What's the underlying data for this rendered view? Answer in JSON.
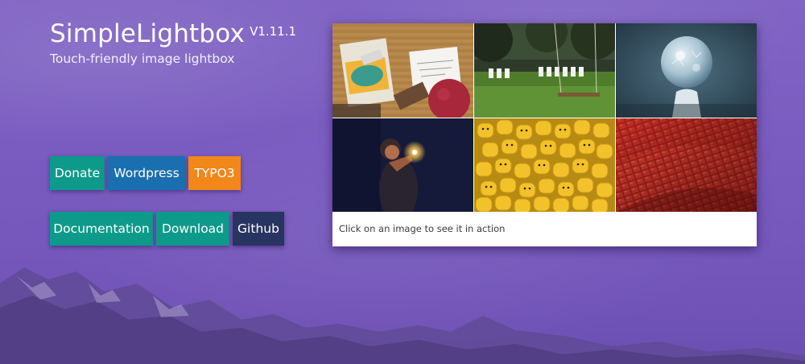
{
  "header": {
    "title": "SimpleLightbox",
    "version": "V1.11.1",
    "subtitle": "Touch-friendly image lightbox"
  },
  "buttons_row1": {
    "donate": "Donate",
    "wordpress": "Wordpress",
    "typo3": "TYPO3"
  },
  "buttons_row2": {
    "documentation": "Documentation",
    "download": "Download",
    "github": "Github"
  },
  "gallery": {
    "caption": "Click on an image to see it in action",
    "images": [
      {
        "icon": "desk-sketch-photo"
      },
      {
        "icon": "tree-swing-photo"
      },
      {
        "icon": "frozen-bubble-photo"
      },
      {
        "icon": "sparkler-person-photo"
      },
      {
        "icon": "lego-heads-photo"
      },
      {
        "icon": "red-tiles-photo"
      }
    ]
  },
  "colors": {
    "background": "#7b5fc2",
    "teal": "#0e9a8a",
    "blue": "#1a6fb0",
    "orange": "#f2871a",
    "navy": "#283462"
  }
}
